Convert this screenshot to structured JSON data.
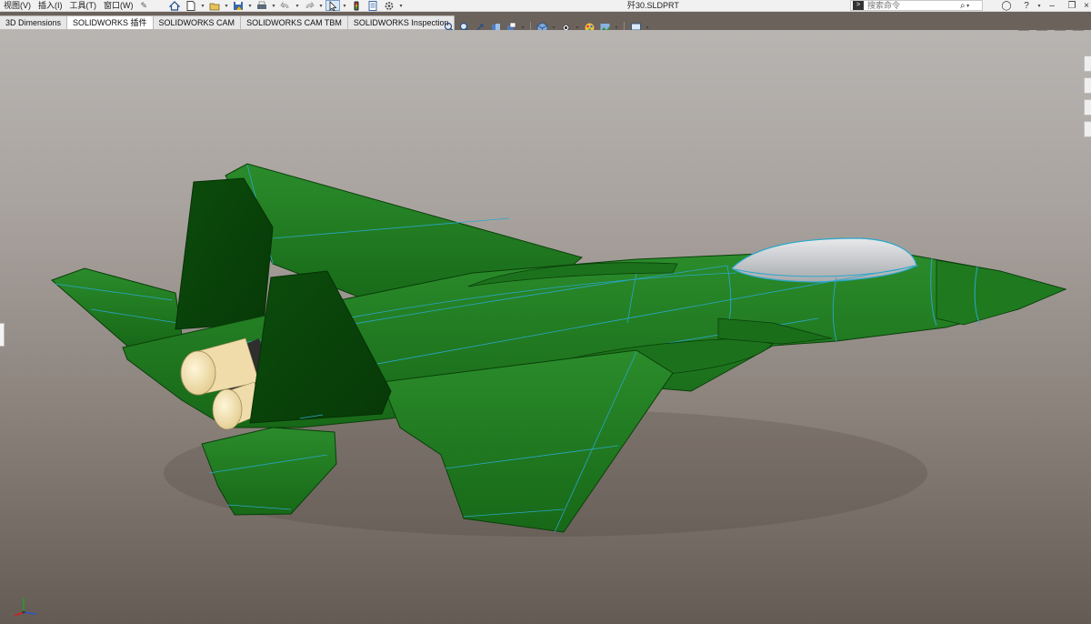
{
  "menu": {
    "items": [
      "视图(V)",
      "插入(I)",
      "工具(T)",
      "窗口(W)"
    ]
  },
  "window": {
    "title": "歼30.SLDPRT"
  },
  "search": {
    "placeholder": "搜索命令"
  },
  "tabs": [
    {
      "label": "3D Dimensions",
      "active": false
    },
    {
      "label": "SOLIDWORKS 插件",
      "active": true
    },
    {
      "label": "SOLIDWORKS CAM",
      "active": false
    },
    {
      "label": "SOLIDWORKS CAM TBM",
      "active": false
    },
    {
      "label": "SOLIDWORKS Inspection",
      "active": false
    }
  ],
  "colors": {
    "model_body": "#1f7a1f",
    "model_dark": "#0f4d0f",
    "model_edge": "#2aa7c9",
    "canopy": "#c7c9cc",
    "nozzle": "#f1deb0",
    "viewport_top": "#b7b4b1",
    "viewport_bottom": "#645b54"
  },
  "icons": {
    "toolbar": [
      "home-icon",
      "new-document-icon",
      "open-icon",
      "save-icon",
      "print-icon",
      "undo-icon",
      "redo-icon",
      "select-icon",
      "rebuild-icon",
      "file-properties-icon",
      "options-icon"
    ],
    "hud": [
      "zoom-to-fit-icon",
      "zoom-to-area-icon",
      "previous-view-icon",
      "section-view-icon",
      "dynamic-annotation-icon",
      "view-orientation-icon",
      "display-style-icon",
      "hide-show-icon",
      "edit-appearance-icon",
      "apply-scene-icon",
      "view-settings-icon"
    ],
    "triad_axes": [
      "x",
      "y",
      "z"
    ]
  }
}
